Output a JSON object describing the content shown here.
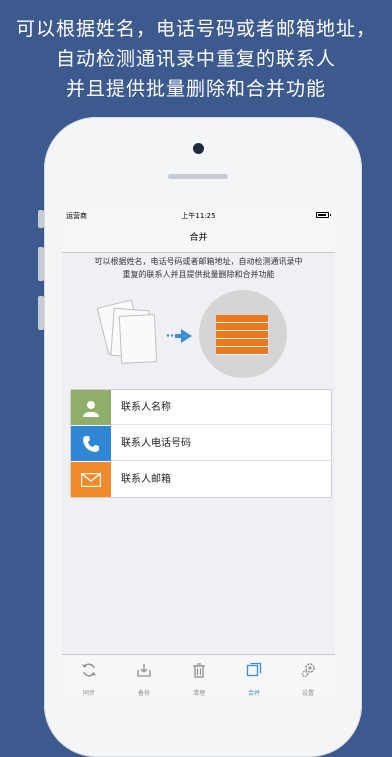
{
  "headline": {
    "line1": "可以根据姓名，电话号码或者邮箱地址，",
    "line2": "自动检测通讯录中重复的联系人",
    "line3": "并且提供批量删除和合并功能"
  },
  "statusbar": {
    "carrier": "运营商",
    "time": "上午11:25",
    "battery_level": 0.9
  },
  "nav": {
    "title": "合并"
  },
  "description": {
    "line1": "可以根据姓名，电话号码或者邮箱地址，自动检测通讯录中",
    "line2": "重复的联系人并且提供批量删除和合并功能"
  },
  "merge_options": [
    {
      "label": "联系人名称",
      "icon": "person-icon",
      "color": "#8fae6a"
    },
    {
      "label": "联系人电话号码",
      "icon": "phone-icon",
      "color": "#2e86d4"
    },
    {
      "label": "联系人邮箱",
      "icon": "mail-icon",
      "color": "#f08a2c"
    }
  ],
  "tabs": [
    {
      "label": "同步",
      "icon": "sync-icon",
      "active": false
    },
    {
      "label": "备份",
      "icon": "backup-icon",
      "active": false
    },
    {
      "label": "清理",
      "icon": "trash-icon",
      "active": false
    },
    {
      "label": "合并",
      "icon": "merge-icon",
      "active": true
    },
    {
      "label": "设置",
      "icon": "gear-icon",
      "active": false
    }
  ],
  "colors": {
    "background": "#3d5a8f",
    "accent": "#3a8fd6",
    "stack": "#ea7a20"
  }
}
